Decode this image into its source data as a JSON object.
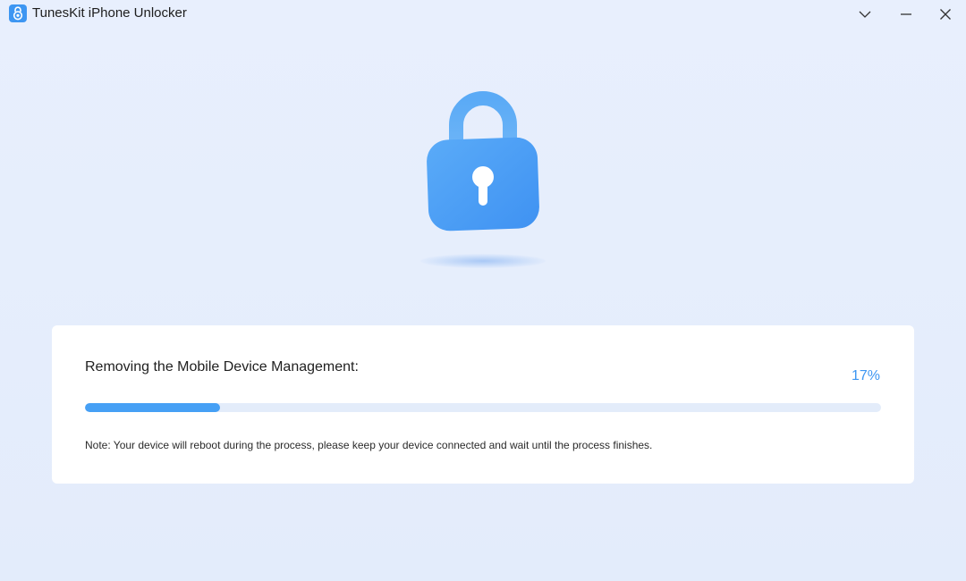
{
  "window": {
    "title": "TunesKit iPhone Unlocker",
    "controls": {
      "menu_icon": "chevron-down-icon",
      "minimize_icon": "minimize-icon",
      "close_icon": "close-icon"
    }
  },
  "illustration": {
    "icon": "lock-icon",
    "color": "#46a0f5"
  },
  "progress": {
    "label": "Removing the Mobile Device Management:",
    "percent_text": "17%",
    "value": 0.17,
    "note": "Note: Your device will reboot during the process, please keep your device connected and wait until the process finishes."
  },
  "colors": {
    "accent": "#3d96f2",
    "background": "#e6eefc",
    "card": "#ffffff",
    "track": "#e3ecfa"
  }
}
